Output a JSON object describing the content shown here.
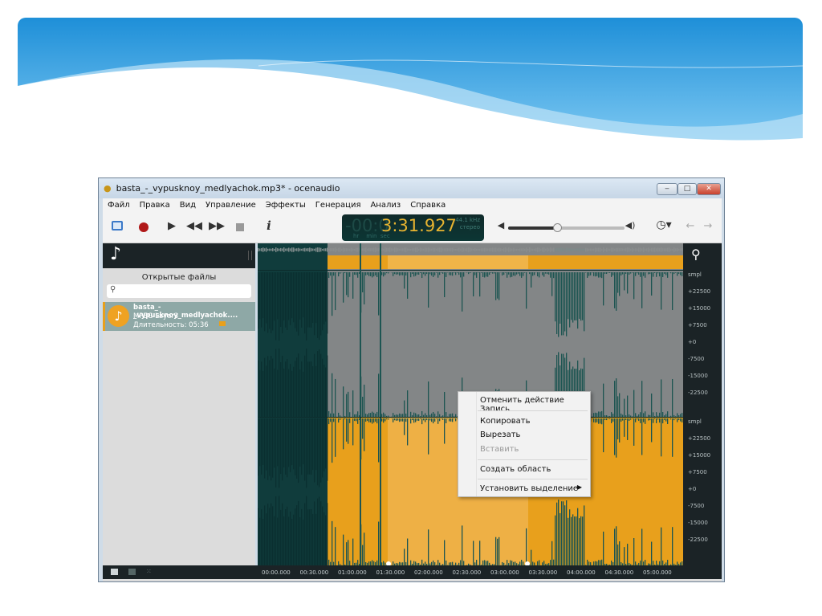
{
  "window": {
    "title": "basta_-_vypusknoy_medlyachok.mp3* - ocenaudio",
    "minimize": "‒",
    "maximize": "□",
    "close": "✕"
  },
  "menu": [
    "Файл",
    "Правка",
    "Вид",
    "Управление",
    "Эффекты",
    "Генерация",
    "Анализ",
    "Справка"
  ],
  "toolbar": {
    "info": "i"
  },
  "time_display": {
    "dim_prefix": "-00:0",
    "time": "3:31.927",
    "units": "hr    min  sec",
    "sample_rate": "44.1 kHz",
    "channels": "стерео"
  },
  "volume_level": 0.42,
  "sidebar": {
    "title": "Открытые файлы",
    "search_placeholder": "",
    "file": {
      "name": "basta_-_vypusknoy_medlyachok....",
      "format": "MPEG Layer3",
      "duration": "Длительность: 05:36"
    }
  },
  "ruler": {
    "top": [
      "smpl",
      "+22500",
      "+15000",
      "+7500",
      "+0",
      "-7500",
      "-15000",
      "-22500"
    ],
    "bottom": [
      "smpl",
      "+22500",
      "+15000",
      "+7500",
      "+0",
      "-7500",
      "-15000",
      "-22500"
    ]
  },
  "timeline": [
    "00:00.000",
    "00:30.000",
    "01:00.000",
    "01:30.000",
    "02:00.000",
    "02:30.000",
    "03:00.000",
    "03:30.000",
    "04:00.000",
    "04:30.000",
    "05:00.000"
  ],
  "context_menu": {
    "undo": "Отменить действие Запись",
    "copy": "Копировать",
    "cut": "Вырезать",
    "paste": "Вставить",
    "create_region": "Создать область",
    "set_selection": "Установить выделение"
  },
  "colors": {
    "accent": "#e8a01c",
    "dark": "#1b2326",
    "teal": "#103c3c",
    "selection_gray": "#838687"
  }
}
